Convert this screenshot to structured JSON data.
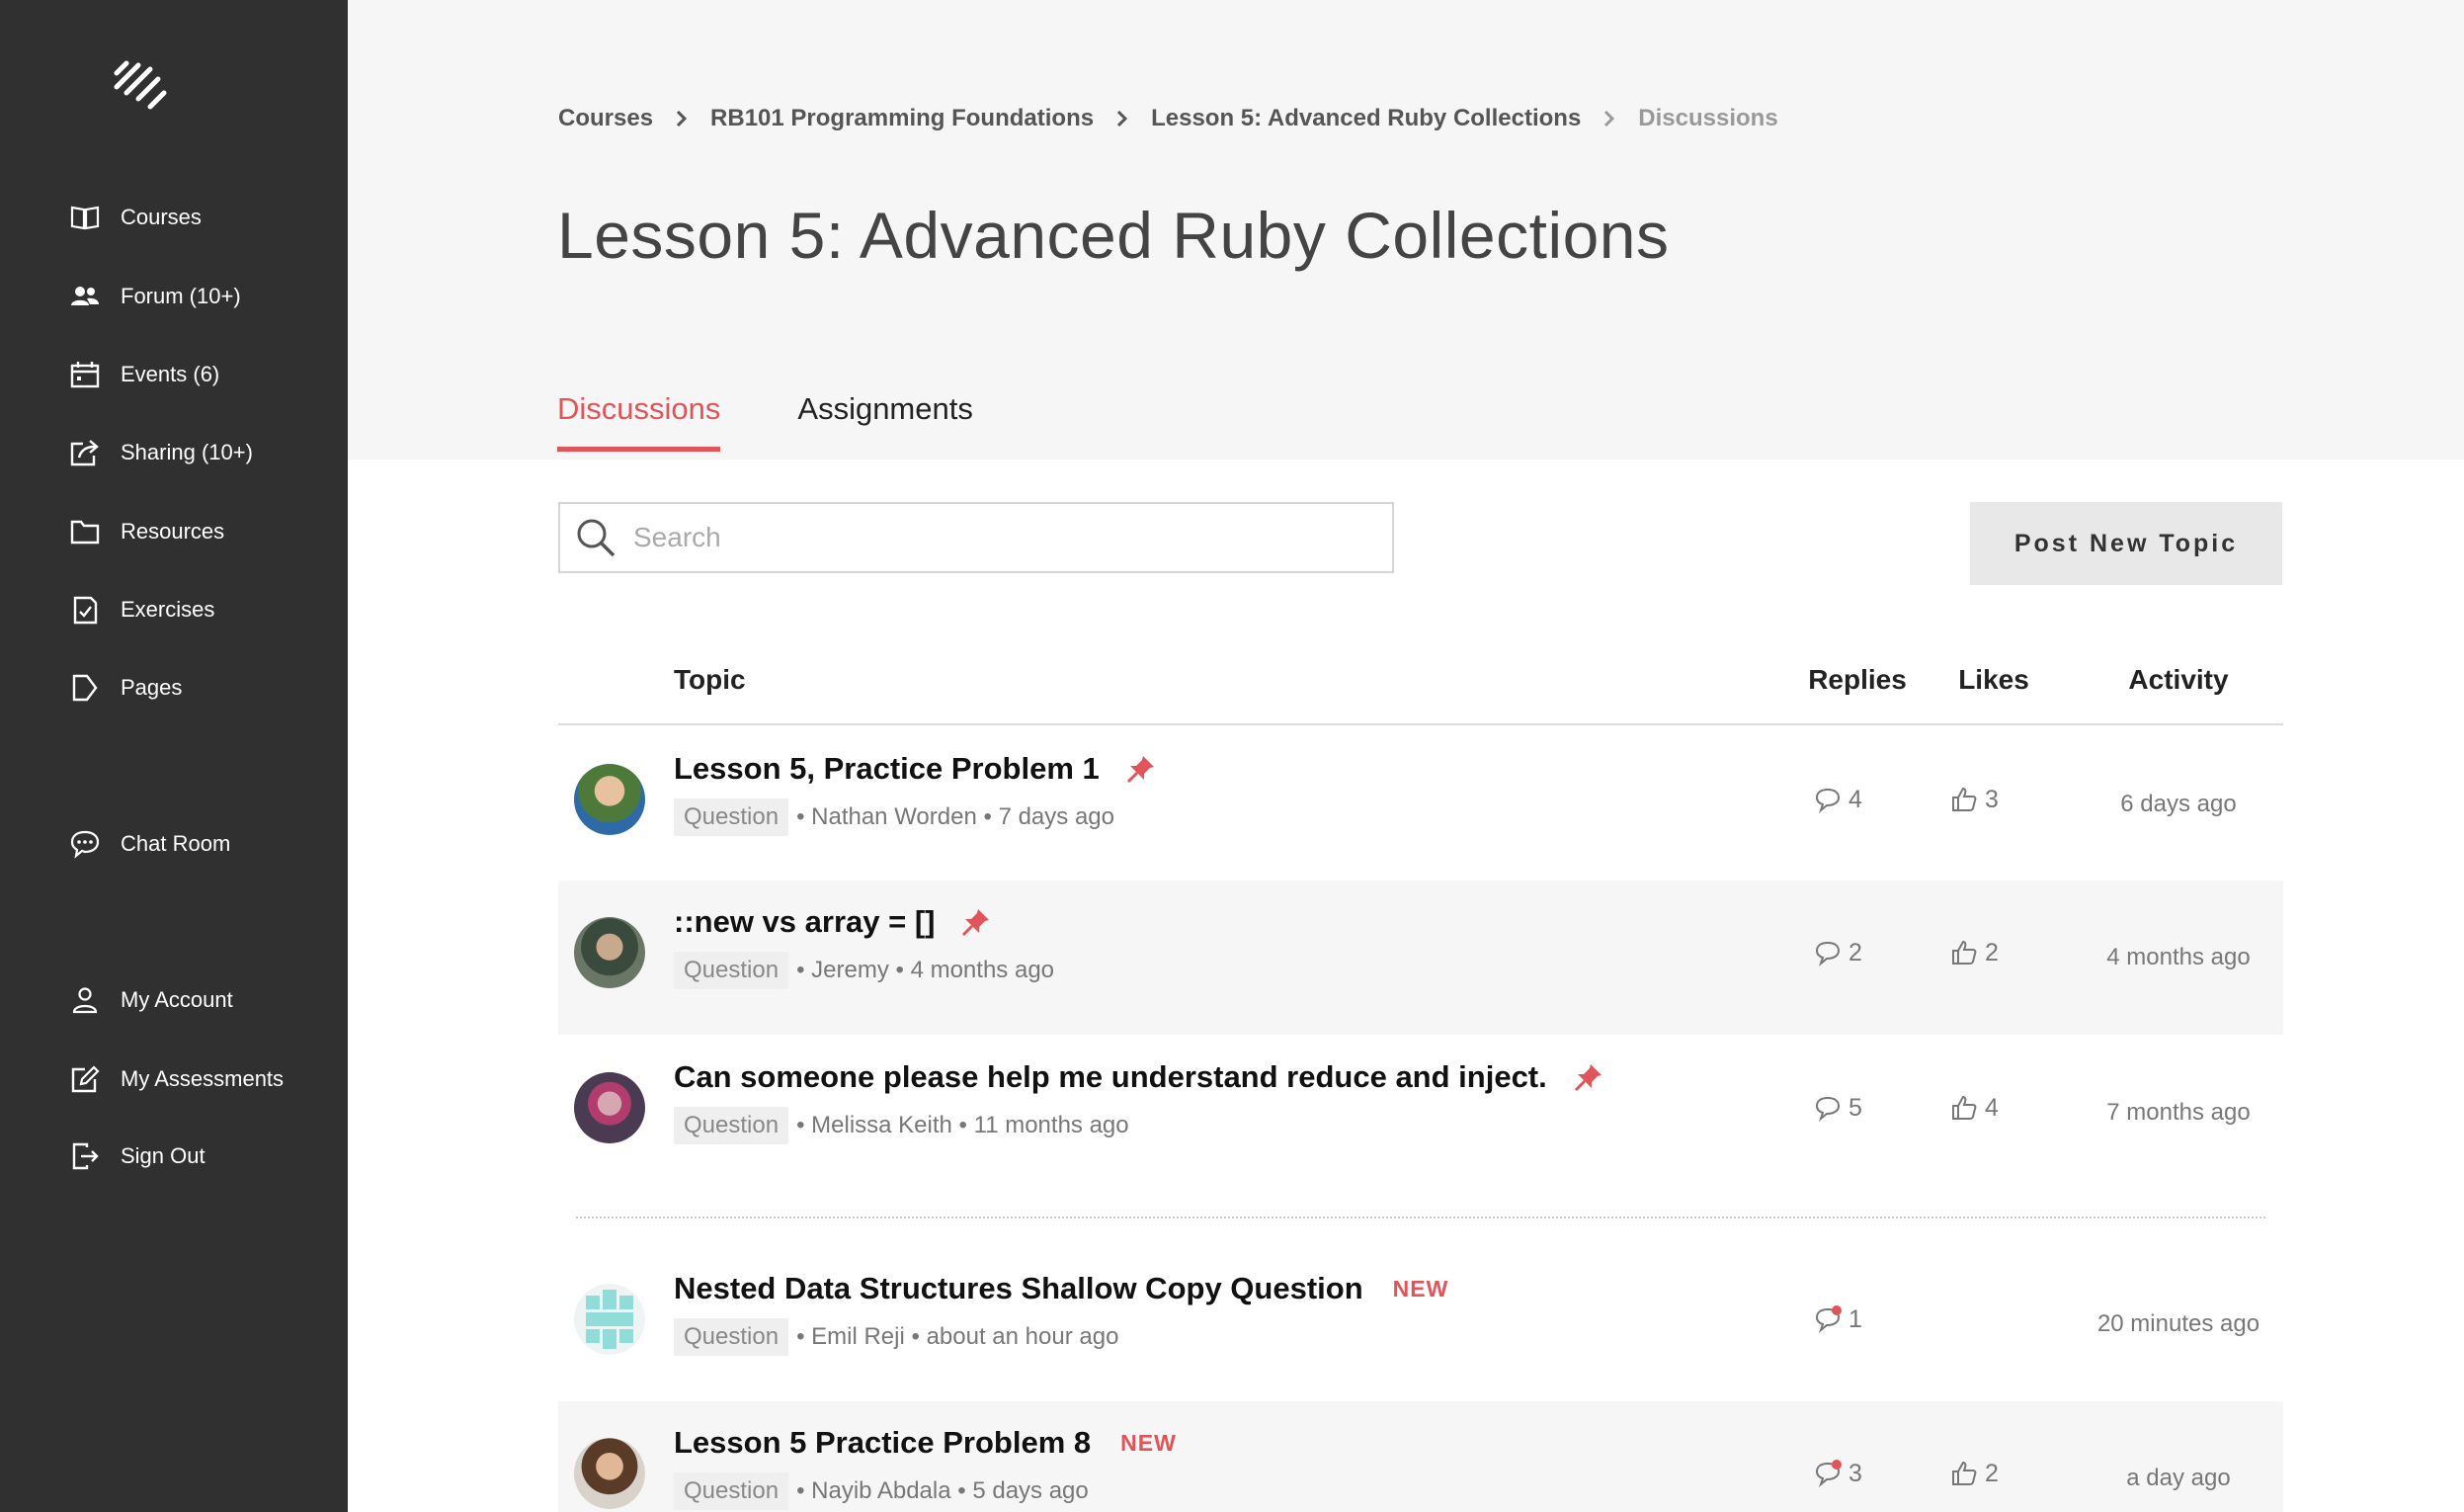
{
  "sidebar": {
    "items": [
      {
        "label": "Courses",
        "icon": "book-icon"
      },
      {
        "label": "Forum (10+)",
        "icon": "users-icon"
      },
      {
        "label": "Events (6)",
        "icon": "calendar-icon"
      },
      {
        "label": "Sharing (10+)",
        "icon": "share-icon"
      },
      {
        "label": "Resources",
        "icon": "folder-icon"
      },
      {
        "label": "Exercises",
        "icon": "checklist-icon"
      },
      {
        "label": "Pages",
        "icon": "tag-icon"
      },
      {
        "label": "Chat Room",
        "icon": "chat-icon"
      },
      {
        "label": "My Account",
        "icon": "user-icon"
      },
      {
        "label": "My Assessments",
        "icon": "edit-icon"
      },
      {
        "label": "Sign Out",
        "icon": "sign-out-icon"
      }
    ]
  },
  "breadcrumb": {
    "items": [
      "Courses",
      "RB101 Programming Foundations",
      "Lesson 5: Advanced Ruby Collections",
      "Discussions"
    ]
  },
  "page": {
    "title": "Lesson 5: Advanced Ruby Collections"
  },
  "tabs": [
    {
      "label": "Discussions",
      "active": true
    },
    {
      "label": "Assignments",
      "active": false
    }
  ],
  "search": {
    "placeholder": "Search",
    "value": ""
  },
  "actions": {
    "post_new_topic": "Post New Topic"
  },
  "table": {
    "headers": {
      "topic": "Topic",
      "replies": "Replies",
      "likes": "Likes",
      "activity": "Activity"
    },
    "rows": [
      {
        "title": "Lesson 5, Practice Problem 1",
        "pinned": true,
        "is_new": false,
        "tag": "Question",
        "author": "Nathan Worden",
        "posted": "7 days ago",
        "replies": "4",
        "likes": "3",
        "activity": "6 days ago",
        "unread": false
      },
      {
        "title": "::new vs array = []",
        "pinned": true,
        "is_new": false,
        "tag": "Question",
        "author": "Jeremy",
        "posted": "4 months ago",
        "replies": "2",
        "likes": "2",
        "activity": "4 months ago",
        "unread": false
      },
      {
        "title": "Can someone please help me understand reduce and inject.",
        "pinned": true,
        "is_new": false,
        "tag": "Question",
        "author": "Melissa Keith",
        "posted": "11 months ago",
        "replies": "5",
        "likes": "4",
        "activity": "7 months ago",
        "unread": false
      },
      {
        "title": "Nested Data Structures Shallow Copy Question",
        "pinned": false,
        "is_new": true,
        "new_label": "NEW",
        "tag": "Question",
        "author": "Emil Reji",
        "posted": "about an hour ago",
        "replies": "1",
        "likes": "",
        "activity": "20 minutes ago",
        "unread": true
      },
      {
        "title": "Lesson 5 Practice Problem 8",
        "pinned": false,
        "is_new": true,
        "new_label": "NEW",
        "tag": "Question",
        "author": "Nayib Abdala",
        "posted": "5 days ago",
        "replies": "3",
        "likes": "2",
        "activity": "a day ago",
        "unread": true
      }
    ]
  },
  "colors": {
    "sidebar_bg": "#303030",
    "accent": "#e0545a",
    "page_bg": "#f6f6f6"
  }
}
